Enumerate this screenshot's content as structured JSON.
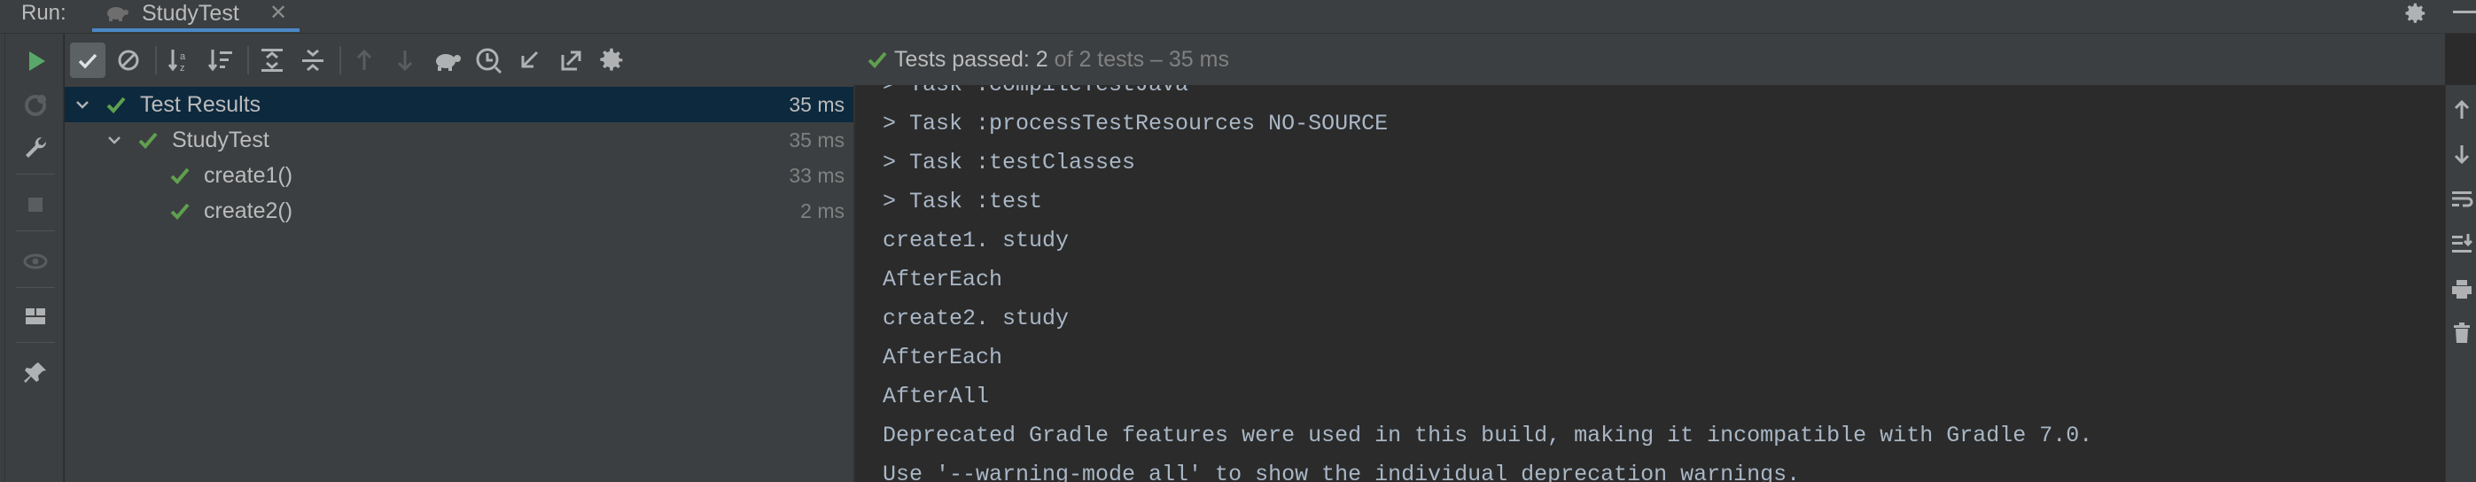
{
  "tab_strip": {
    "run_label": "Run:",
    "tab_title": "StudyTest",
    "tab_close": "✕"
  },
  "status": {
    "passed_prefix": "Tests passed: 2",
    "passed_suffix": " of 2 tests – 35 ms"
  },
  "tree": {
    "rows": [
      {
        "label": "Test Results",
        "time": "35 ms"
      },
      {
        "label": "StudyTest",
        "time": "35 ms"
      },
      {
        "label": "create1()",
        "time": "33 ms"
      },
      {
        "label": "create2()",
        "time": "2 ms"
      }
    ]
  },
  "console": {
    "lines": [
      "> Task :compileTestJava",
      "> Task :processTestResources NO-SOURCE",
      "> Task :testClasses",
      "> Task :test",
      "create1. study",
      "AfterEach",
      "create2. study",
      "AfterEach",
      "AfterAll",
      "Deprecated Gradle features were used in this build, making it incompatible with Gradle 7.0.",
      "Use '--warning-mode all' to show the individual deprecation warnings."
    ]
  },
  "icons": {
    "run": "run-icon",
    "rerun_failed": "rerun-failed-icon",
    "settings": "wrench-icon",
    "stop": "stop-icon",
    "show_passed": "show-passed-icon",
    "show_ignored": "show-ignored-icon",
    "sort_alpha": "sort-alpha-icon",
    "sort_duration": "sort-duration-icon",
    "expand_all": "expand-all-icon",
    "collapse_all": "collapse-all-icon",
    "prev_failed": "arrow-up-icon",
    "next_failed": "arrow-down-icon",
    "tortoise": "tortoise-icon",
    "history": "history-icon",
    "import": "import-tests-icon",
    "export": "export-tests-icon",
    "gear": "gear-icon"
  },
  "colors": {
    "accent_green": "#5fa04e",
    "run_green": "#59a869",
    "selection": "#0d293e",
    "panel": "#3c3f41",
    "console_bg": "#2b2b2b"
  }
}
